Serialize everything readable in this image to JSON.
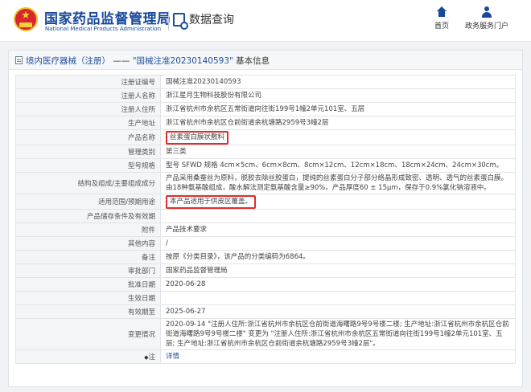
{
  "header": {
    "brand_cn": "国家药品监督管理局",
    "brand_en": "National Medical Products Administration",
    "section_title": "数据查询",
    "nav": [
      {
        "label": "首页",
        "icon": "home-icon"
      },
      {
        "label": "政务服务门户",
        "icon": "user-icon"
      }
    ]
  },
  "breadcrumb": {
    "category": "境内医疗器械（注册）",
    "separator": " —— ",
    "current": "\"国械注准20230140593\"",
    "suffix": " 基本信息"
  },
  "fields": [
    {
      "label": "注册证编号",
      "value": "国械注准20230140593"
    },
    {
      "label": "注册人名称",
      "value": "浙江星月生物科技股份有限公司"
    },
    {
      "label": "注册人住所",
      "value": "浙江省杭州市余杭区五常街道向往街199号1幢2单元101室、五层"
    },
    {
      "label": "生产地址",
      "value": "浙江省杭州市余杭区仓前街道余杭塘路2959号3幢2层"
    },
    {
      "label": "产品名称",
      "value": "丝素蛋白膜状敷料"
    },
    {
      "label": "管理类别",
      "value": "第三类"
    },
    {
      "label": "型号规格",
      "value": "型号 SFWD 规格 4cm×5cm、6cm×8cm、8cm×12cm、12cm×18cm、18cm×24cm、24cm×30cm。"
    },
    {
      "label": "结构及组成/主要组成成分",
      "value": "产品采用桑蚕丝为原料，脱胶去除丝胶蛋白，提纯的丝素蛋白分子部分络晶形成致密、透明、透气的丝素蛋白膜。由18种氨基酸组成，酸水解法测定氨基酸含量≥90%。产品厚度60 ± 15μm，保存于0.9%氯化钠溶液中。"
    },
    {
      "label": "适用范围/预期用途",
      "value": "本产品适用于供皮区覆盖。"
    },
    {
      "label": "产品储存条件及有效期",
      "value": ""
    },
    {
      "label": "附件",
      "value": "产品技术要求"
    },
    {
      "label": "其他内容",
      "value": "/"
    },
    {
      "label": "备注",
      "value": "按原《分类目录》，该产品的分类编码为6864。"
    },
    {
      "label": "审批部门",
      "value": "国家药品监督管理局"
    },
    {
      "label": "批准日期",
      "value": "2020-06-28"
    },
    {
      "label": "生效日期",
      "value": ""
    },
    {
      "label": "有效期至",
      "value": "2025-06-27"
    },
    {
      "label": "变更情况",
      "value": "2020-09-14 \"注册人住所:浙江省杭州市余杭区仓前街道海曙路9号9号楼二楼; 生产地址:浙江省杭州市余杭区仓前街道海曙路9号9号楼二楼\" 变更为 \"注册人住所:浙江省杭州市余杭区五常街道向往街199号1幢2单元101室、五层; 生产地址:浙江省杭州市余杭区仓前街道余杭塘路2959号3幢2层\"。"
    },
    {
      "label": "注",
      "value": "详情"
    }
  ],
  "colors": {
    "brand_blue": "#16489b",
    "highlight_red": "#e32b2b"
  }
}
